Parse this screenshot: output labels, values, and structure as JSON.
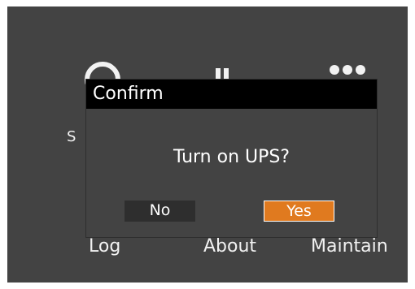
{
  "background": {
    "label_s": "S",
    "tabs": [
      "Log",
      "About",
      "Maintain"
    ],
    "icons": [
      "power-icon",
      "signal-icon",
      "status-dots-icon"
    ]
  },
  "dialog": {
    "title": "Confirm",
    "message": "Turn on UPS?",
    "no_label": "No",
    "yes_label": "Yes"
  },
  "colors": {
    "screen_bg": "#434343",
    "header_bg": "#000000",
    "accent": "#e07a1f",
    "button_dark": "#2e2e2e",
    "text": "#ffffff"
  }
}
